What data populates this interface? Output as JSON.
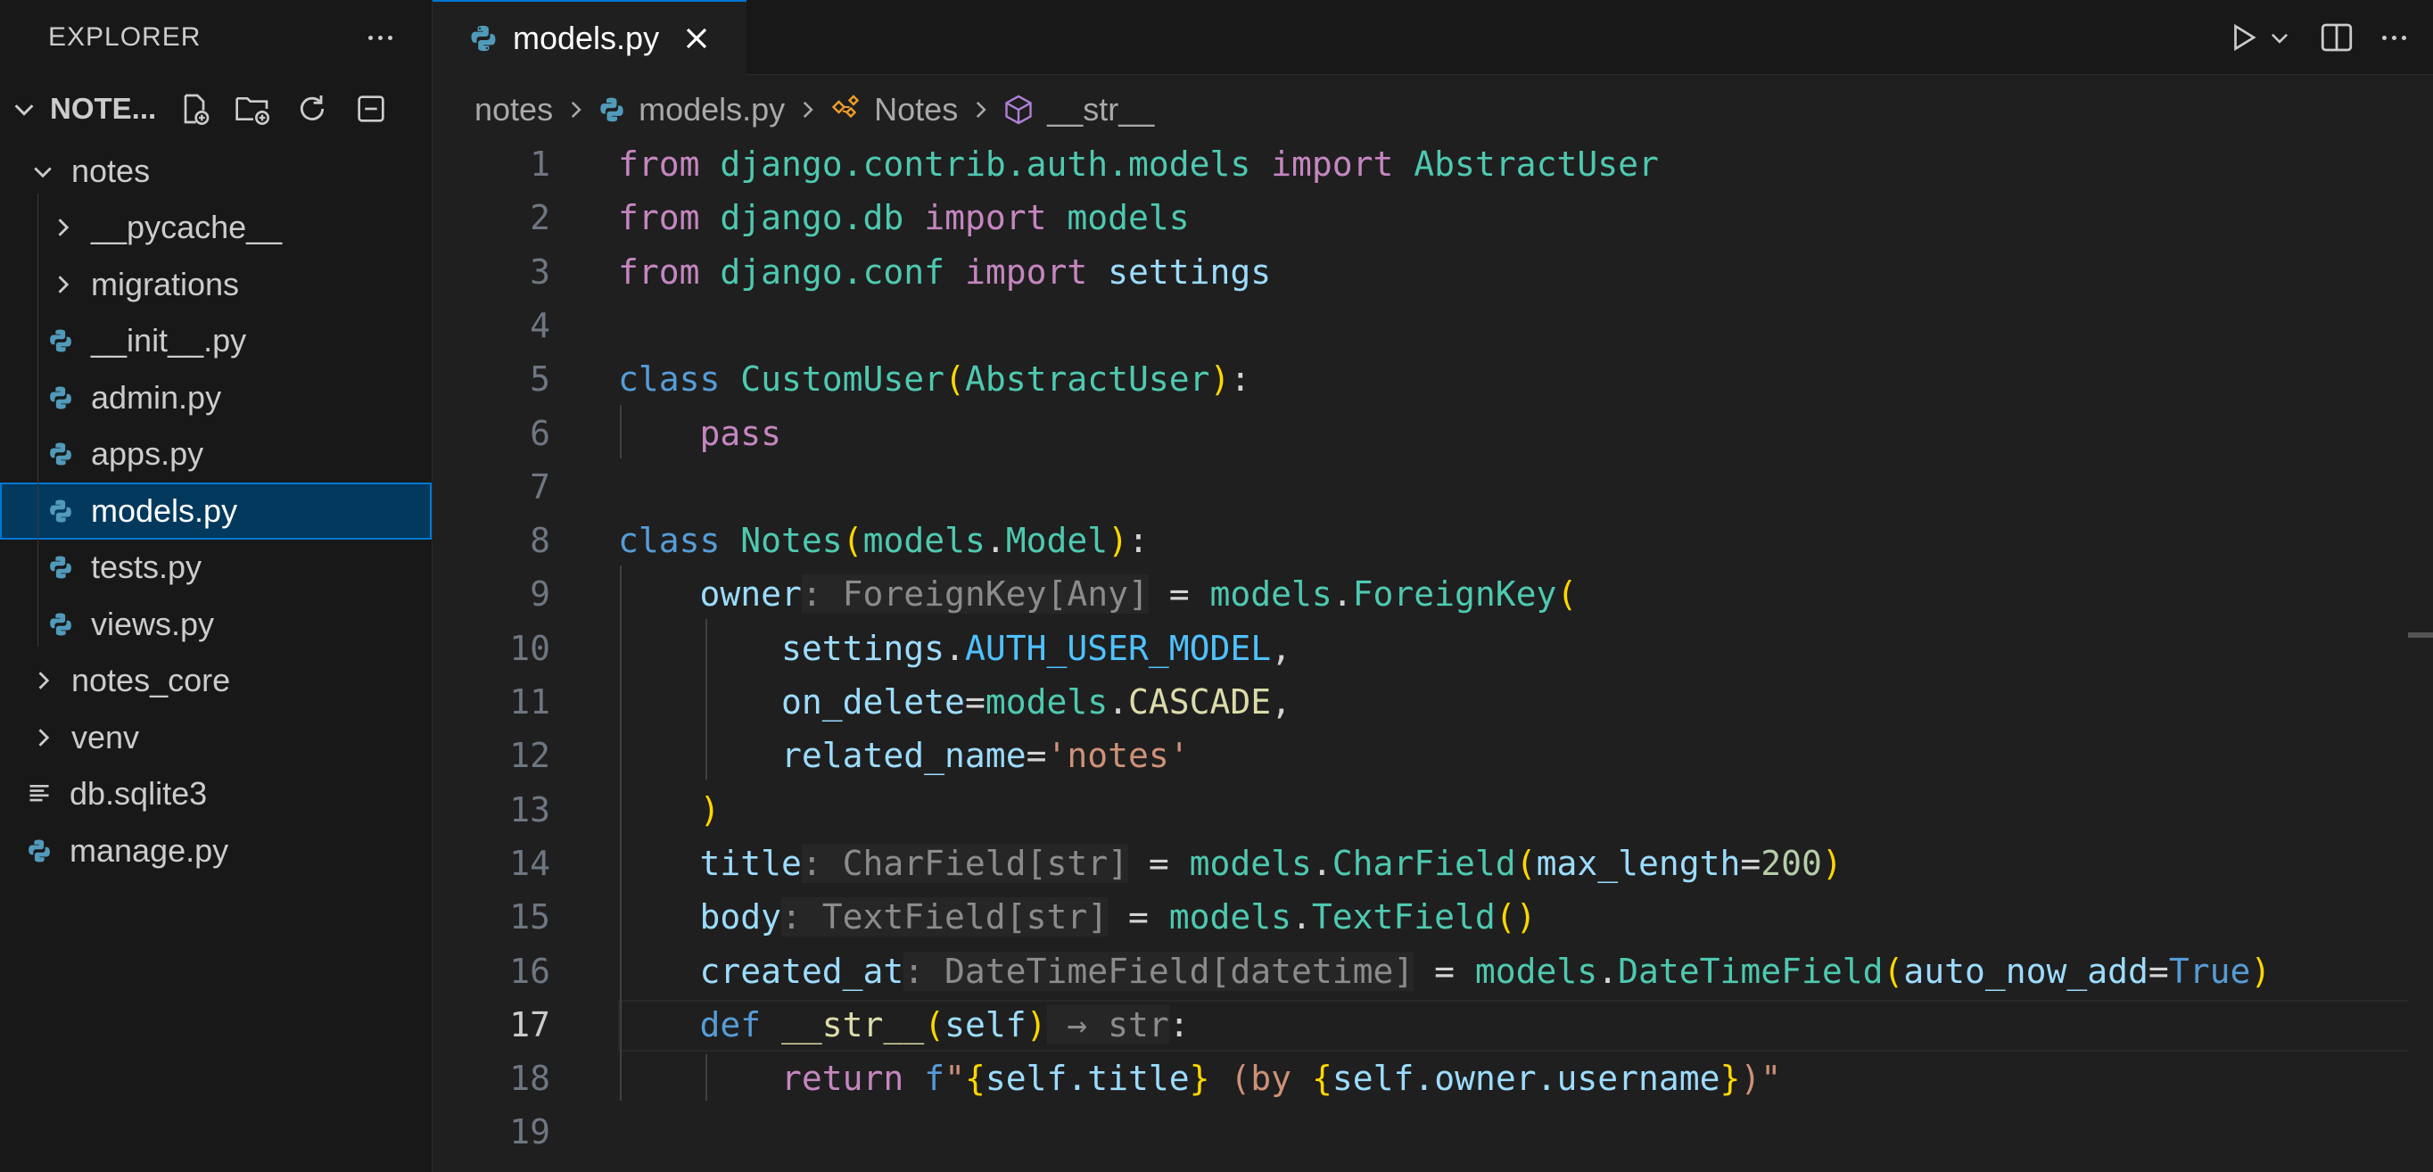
{
  "explorer": {
    "title": "EXPLORER",
    "section": "NOTE...",
    "tree": [
      {
        "label": "notes",
        "type": "folder-open",
        "indent": 1
      },
      {
        "label": "__pycache__",
        "type": "folder",
        "indent": 2
      },
      {
        "label": "migrations",
        "type": "folder",
        "indent": 2
      },
      {
        "label": "__init__.py",
        "type": "py",
        "indent": 2
      },
      {
        "label": "admin.py",
        "type": "py",
        "indent": 2
      },
      {
        "label": "apps.py",
        "type": "py",
        "indent": 2
      },
      {
        "label": "models.py",
        "type": "py",
        "indent": 2,
        "selected": true
      },
      {
        "label": "tests.py",
        "type": "py",
        "indent": 2
      },
      {
        "label": "views.py",
        "type": "py",
        "indent": 2
      },
      {
        "label": "notes_core",
        "type": "folder",
        "indent": 1
      },
      {
        "label": "venv",
        "type": "folder",
        "indent": 1
      },
      {
        "label": "db.sqlite3",
        "type": "text",
        "indent": 1
      },
      {
        "label": "manage.py",
        "type": "py",
        "indent": 1
      }
    ]
  },
  "tab": {
    "label": "models.py"
  },
  "breadcrumb": {
    "folder": "notes",
    "file": "models.py",
    "class": "Notes",
    "method": "__str__"
  },
  "editor": {
    "active_line": 17,
    "line_numbers": [
      "1",
      "2",
      "3",
      "4",
      "5",
      "6",
      "7",
      "8",
      "9",
      "10",
      "11",
      "12",
      "13",
      "14",
      "15",
      "16",
      "17",
      "18",
      "19"
    ],
    "lines": [
      [
        [
          "kw2",
          "from"
        ],
        [
          "op",
          " "
        ],
        [
          "mod",
          "django.contrib.auth.models"
        ],
        [
          "op",
          " "
        ],
        [
          "kw2",
          "import"
        ],
        [
          "op",
          " "
        ],
        [
          "cls",
          "AbstractUser"
        ]
      ],
      [
        [
          "kw2",
          "from"
        ],
        [
          "op",
          " "
        ],
        [
          "mod",
          "django.db"
        ],
        [
          "op",
          " "
        ],
        [
          "kw2",
          "import"
        ],
        [
          "op",
          " "
        ],
        [
          "mod",
          "models"
        ]
      ],
      [
        [
          "kw2",
          "from"
        ],
        [
          "op",
          " "
        ],
        [
          "mod",
          "django.conf"
        ],
        [
          "op",
          " "
        ],
        [
          "kw2",
          "import"
        ],
        [
          "op",
          " "
        ],
        [
          "var",
          "settings"
        ]
      ],
      [],
      [
        [
          "kw",
          "class"
        ],
        [
          "op",
          " "
        ],
        [
          "cls",
          "CustomUser"
        ],
        [
          "par",
          "("
        ],
        [
          "cls",
          "AbstractUser"
        ],
        [
          "par",
          ")"
        ],
        [
          "op",
          ":"
        ]
      ],
      [
        [
          "op",
          "    "
        ],
        [
          "kw2",
          "pass"
        ]
      ],
      [],
      [
        [
          "kw",
          "class"
        ],
        [
          "op",
          " "
        ],
        [
          "cls",
          "Notes"
        ],
        [
          "par",
          "("
        ],
        [
          "mod",
          "models"
        ],
        [
          "op",
          "."
        ],
        [
          "cls",
          "Model"
        ],
        [
          "par",
          ")"
        ],
        [
          "op",
          ":"
        ]
      ],
      [
        [
          "op",
          "    "
        ],
        [
          "var",
          "owner"
        ],
        [
          "hint",
          ": ForeignKey[Any]"
        ],
        [
          "op",
          " = "
        ],
        [
          "mod",
          "models"
        ],
        [
          "op",
          "."
        ],
        [
          "cls",
          "ForeignKey"
        ],
        [
          "par",
          "("
        ]
      ],
      [
        [
          "op",
          "        "
        ],
        [
          "var",
          "settings"
        ],
        [
          "op",
          "."
        ],
        [
          "const",
          "AUTH_USER_MODEL"
        ],
        [
          "op",
          ","
        ]
      ],
      [
        [
          "op",
          "        "
        ],
        [
          "var",
          "on_delete"
        ],
        [
          "op",
          "="
        ],
        [
          "mod",
          "models"
        ],
        [
          "op",
          "."
        ],
        [
          "fn",
          "CASCADE"
        ],
        [
          "op",
          ","
        ]
      ],
      [
        [
          "op",
          "        "
        ],
        [
          "var",
          "related_name"
        ],
        [
          "op",
          "="
        ],
        [
          "str",
          "'notes'"
        ]
      ],
      [
        [
          "op",
          "    "
        ],
        [
          "par",
          ")"
        ]
      ],
      [
        [
          "op",
          "    "
        ],
        [
          "var",
          "title"
        ],
        [
          "hint",
          ": CharField[str]"
        ],
        [
          "op",
          " = "
        ],
        [
          "mod",
          "models"
        ],
        [
          "op",
          "."
        ],
        [
          "cls",
          "CharField"
        ],
        [
          "par",
          "("
        ],
        [
          "var",
          "max_length"
        ],
        [
          "op",
          "="
        ],
        [
          "num",
          "200"
        ],
        [
          "par",
          ")"
        ]
      ],
      [
        [
          "op",
          "    "
        ],
        [
          "var",
          "body"
        ],
        [
          "hint",
          ": TextField[str]"
        ],
        [
          "op",
          " = "
        ],
        [
          "mod",
          "models"
        ],
        [
          "op",
          "."
        ],
        [
          "cls",
          "TextField"
        ],
        [
          "par",
          "()"
        ]
      ],
      [
        [
          "op",
          "    "
        ],
        [
          "var",
          "created_at"
        ],
        [
          "hint",
          ": DateTimeField[datetime]"
        ],
        [
          "op",
          " = "
        ],
        [
          "mod",
          "models"
        ],
        [
          "op",
          "."
        ],
        [
          "cls",
          "DateTimeField"
        ],
        [
          "par",
          "("
        ],
        [
          "var",
          "auto_now_add"
        ],
        [
          "op",
          "="
        ],
        [
          "kw",
          "True"
        ],
        [
          "par",
          ")"
        ]
      ],
      [
        [
          "op",
          "    "
        ],
        [
          "kw",
          "def"
        ],
        [
          "op",
          " "
        ],
        [
          "fn",
          "__str__"
        ],
        [
          "par",
          "("
        ],
        [
          "var",
          "self"
        ],
        [
          "par",
          ")"
        ],
        [
          "hint",
          " → str"
        ],
        [
          "op",
          ":"
        ]
      ],
      [
        [
          "op",
          "        "
        ],
        [
          "kw2",
          "return"
        ],
        [
          "op",
          " "
        ],
        [
          "kw",
          "f"
        ],
        [
          "fstr",
          "\""
        ],
        [
          "par",
          "{"
        ],
        [
          "var",
          "self.title"
        ],
        [
          "par",
          "}"
        ],
        [
          "fstr",
          " (by "
        ],
        [
          "par",
          "{"
        ],
        [
          "var",
          "self.owner.username"
        ],
        [
          "par",
          "}"
        ],
        [
          "fstr",
          ")\""
        ]
      ],
      []
    ]
  }
}
